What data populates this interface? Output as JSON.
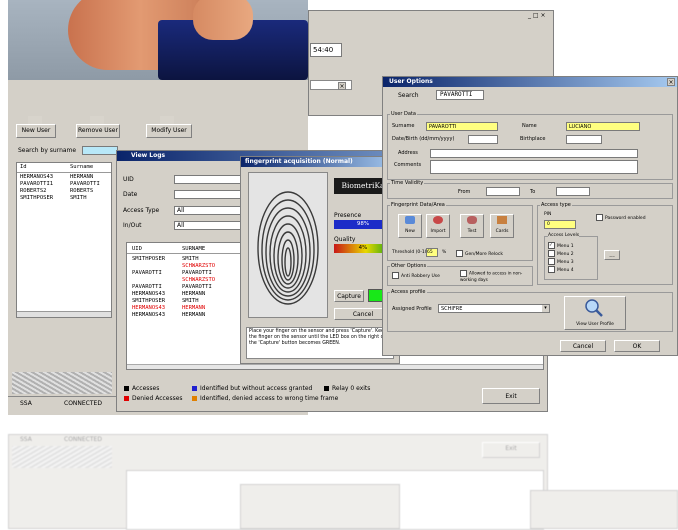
{
  "main_window": {
    "title_controls": "_ □ ×",
    "time_display": "54:40",
    "toolbar_buttons": [
      "New User",
      "Remove User",
      "Modify User"
    ],
    "search_label": "Search by surname",
    "list_headers": [
      "Id",
      "Surname"
    ],
    "list_rows": [
      [
        "HERMANOS43",
        "HERMANN"
      ],
      [
        "PAVAROTTI1",
        "PAVAROTTI"
      ],
      [
        "ROBERTS2",
        "ROBERTS"
      ],
      [
        "SMITHPOSER",
        "SMITH"
      ]
    ],
    "status": [
      "SSA",
      "CONNECTED"
    ]
  },
  "view_logs": {
    "title": "View Logs",
    "fields": [
      {
        "label": "UID",
        "value": ""
      },
      {
        "label": "Date",
        "value": ""
      },
      {
        "label": "Access Type",
        "value": "All"
      },
      {
        "label": "In/Out",
        "value": "All"
      }
    ],
    "table_headers": [
      "UID",
      "SURNAME"
    ],
    "rows": [
      {
        "uid": "SMITHPOSER",
        "surname": "SMITH",
        "color": "#000000"
      },
      {
        "uid": "",
        "surname": "SCHWARZSTO",
        "color": "#e00000"
      },
      {
        "uid": "PAVAROTTI",
        "surname": "PAVAROTTI",
        "color": "#000000"
      },
      {
        "uid": "",
        "surname": "SCHWARZSTO",
        "color": "#e00000"
      },
      {
        "uid": "PAVAROTTI",
        "surname": "PAVAROTTI",
        "color": "#000000"
      },
      {
        "uid": "HERMANOS43",
        "surname": "HERMANN",
        "color": "#000000"
      },
      {
        "uid": "SMITHPOSER",
        "surname": "SMITH",
        "color": "#000000"
      },
      {
        "uid": "HERMANOS43",
        "surname": "HERMANN",
        "color": "#e00000"
      },
      {
        "uid": "HERMANOS43",
        "surname": "HERMANN",
        "color": "#000000"
      }
    ],
    "legend": [
      {
        "color": "#000000",
        "text": "Accesses"
      },
      {
        "color": "#2020d0",
        "text": "Identified but without access granted"
      },
      {
        "color": "#000000",
        "text": "Relay 0 exits"
      },
      {
        "color": "#e00000",
        "text": "Denied Accesses"
      },
      {
        "color": "#e08000",
        "text": "Identified, denied access to wrong time frame"
      }
    ],
    "exit_label": "Exit"
  },
  "fingerprint": {
    "title": "fingerprint acquisition (Normal)",
    "logo": "BiometriKa",
    "presence_label": "Presence",
    "presence_value": "98%",
    "quality_label": "Quality",
    "quality_value": "4%",
    "capture_label": "Capture",
    "cancel_label": "Cancel",
    "instructions": "Place your finger on the sensor and press 'Capture'. Keep the finger on the sensor until the LED box on the right of the 'Capture' button becomes GREEN."
  },
  "user_options": {
    "title": "User Options",
    "tab_label": "Search",
    "tab_value": "PAVAROTTI",
    "user_data_label": "User Data",
    "surname_label": "Surname",
    "surname_value": "PAVAROTTI",
    "name_label": "Name",
    "name_value": "LUCIANO",
    "birth_label": "Date/Birth (dd/mm/yyyy)",
    "birthplace_label": "Birthplace",
    "address_label": "Address",
    "comments_label": "Comments",
    "validity_label": "Time Validity",
    "from_label": "From",
    "to_label": "To",
    "fingerprint_label": "Fingerprint Data/Area",
    "icon_buttons": [
      "New",
      "Import",
      "Test",
      "Cards"
    ],
    "threshold_label": "Threshold (0-100)",
    "threshold_value": "65",
    "threshold_unit": "%",
    "gen_label": "Gen/More Relock",
    "other_options_label": "Other Options",
    "anti_label": "Anti Robbery Use",
    "allowed_label": "Allowed to access in non-working days",
    "access_type_label": "Access type",
    "pin_label": "PIN",
    "pin_value": "0",
    "password_label": "Password enabled",
    "access_levels_label": "Access Levels",
    "level_items": [
      "Menu 1",
      "Menu 2",
      "Menu 3",
      "Menu 4"
    ],
    "more_button": "...",
    "access_profile_label": "Access profile",
    "profile_label": "Assigned Profile",
    "profile_value": "SCHIFRE",
    "view_profile_label": "View User Profile",
    "cancel_label": "Cancel",
    "ok_label": "OK"
  },
  "reflection": {
    "status": [
      "SSA",
      "CONNECTED"
    ],
    "exit_label": "Exit"
  }
}
